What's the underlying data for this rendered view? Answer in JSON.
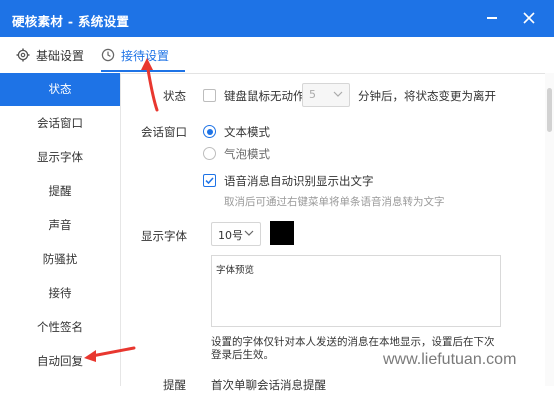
{
  "window": {
    "title": "硬核素材 - 系统设置"
  },
  "tabs": [
    {
      "label": "基础设置",
      "icon": "gear-icon"
    },
    {
      "label": "接待设置",
      "icon": "clock-icon",
      "active": true
    }
  ],
  "sidebar": {
    "items": [
      {
        "label": "状态"
      },
      {
        "label": "会话窗口"
      },
      {
        "label": "显示字体"
      },
      {
        "label": "提醒"
      },
      {
        "label": "声音"
      },
      {
        "label": "防骚扰"
      },
      {
        "label": "接待"
      },
      {
        "label": "个性签名"
      },
      {
        "label": "自动回复"
      }
    ],
    "active_index": 0
  },
  "status": {
    "label": "状态",
    "checkbox_label": "键盘鼠标无动作",
    "checked": false,
    "minutes_value": "5",
    "suffix": "分钟后，将状态变更为离开"
  },
  "session": {
    "label": "会话窗口",
    "text_mode": "文本模式",
    "bubble_mode": "气泡模式",
    "selected": "文本模式",
    "voice_checkbox_label": "语音消息自动识别显示出文字",
    "voice_checked": true,
    "voice_hint": "取消后可通过右键菜单将单条语音消息转为文字"
  },
  "font": {
    "label": "显示字体",
    "size_value": "10号",
    "color": "#000000",
    "preview_text": "字体预览",
    "note": "设置的字体仅针对本人发送的消息在本地显示，设置后在下次登录后生效。"
  },
  "reminder": {
    "label": "提醒",
    "first_option": "首次单聊会话消息提醒"
  },
  "colors": {
    "accent": "#1e73e6",
    "arrow": "#e8372f"
  },
  "watermark": "www.liefutuan.com"
}
